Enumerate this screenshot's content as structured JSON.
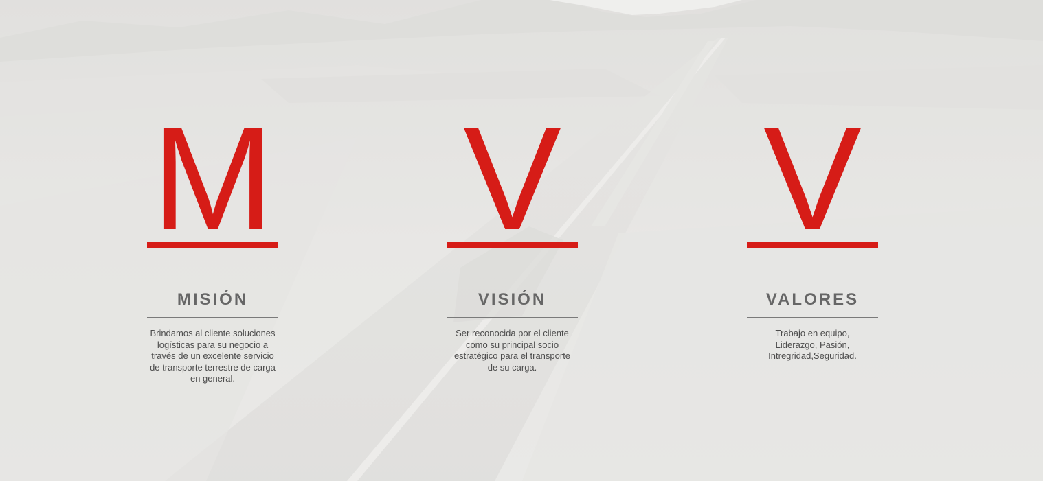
{
  "colors": {
    "accent_red": "#d61c17",
    "title_grey": "#666666",
    "text_grey": "#4d4d4d",
    "overlay": "#e9e8e6"
  },
  "background": {
    "icon": "desert-highway-aerial-photo"
  },
  "sections": [
    {
      "letter": "M",
      "title": "MISIÓN",
      "text": "Brindamos al cliente soluciones logísticas para su negocio a través de un excelente servicio de transporte terrestre de carga en general."
    },
    {
      "letter": "V",
      "title": "VISIÓN",
      "text": "Ser reconocida por el cliente como su principal socio estratégico para el transporte de su carga."
    },
    {
      "letter": "V",
      "title": "VALORES",
      "text": "Trabajo en  equipo,\nLiderazgo,  Pasión,\nIntregridad,Seguridad."
    }
  ]
}
